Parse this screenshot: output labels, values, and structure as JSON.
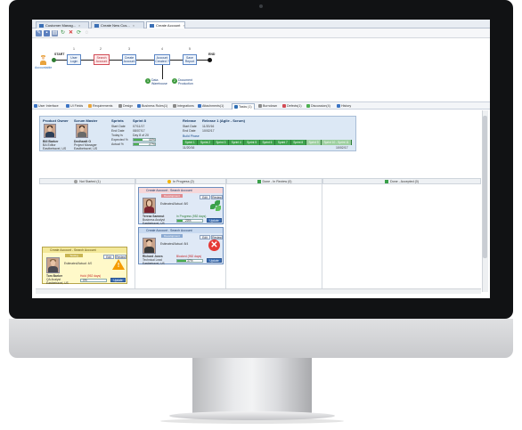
{
  "tabs": [
    {
      "label": "Customer Manag...",
      "active": false
    },
    {
      "label": "Create New Cus...",
      "active": false
    },
    {
      "label": "Create Account",
      "active": true
    }
  ],
  "toolbar": {
    "icons": [
      "edit-icon",
      "save-icon",
      "print-icon",
      "refresh-icon",
      "delete-icon",
      "workflow-icon",
      "help-icon"
    ]
  },
  "workflow": {
    "actor": "Accountable",
    "start": "START",
    "end": "END",
    "steps": [
      {
        "num": "1",
        "label": "User Login"
      },
      {
        "num": "2",
        "label": "Search Account",
        "current": true
      },
      {
        "num": "3",
        "label": "Create Account"
      },
      {
        "num": "4",
        "label": "Account Created ?"
      },
      {
        "num": "5",
        "label": "Save Report"
      }
    ],
    "branch": [
      {
        "num": "1",
        "label": "Data Warehouse"
      },
      {
        "num": "2",
        "label": "Document Production"
      }
    ]
  },
  "section_tabs": [
    {
      "label": "User Interface",
      "color": "#3b74c4"
    },
    {
      "label": "UI Fields",
      "color": "#3b74c4"
    },
    {
      "label": "Requirements",
      "color": "#e9a53a"
    },
    {
      "label": "Design",
      "color": "#8a8a8a"
    },
    {
      "label": "Business Rules(1)",
      "color": "#3b74c4"
    },
    {
      "label": "Integrations",
      "color": "#8a8a8a"
    },
    {
      "label": "Attachments(1)",
      "color": "#3b74c4"
    },
    {
      "label": "Tasks (1)",
      "color": "#2f6eb3",
      "active": true
    },
    {
      "label": "Burndown",
      "color": "#8a8a8a"
    },
    {
      "label": "Defects(1)",
      "color": "#d24b55"
    },
    {
      "label": "Discussion(4)",
      "color": "#4caf50"
    },
    {
      "label": "History",
      "color": "#3b74c4"
    }
  ],
  "info": {
    "product_owner": {
      "title": "Product Owner",
      "name": "Bill Barker",
      "role": "BA Editor",
      "place": "Eastbetravel, US"
    },
    "scrum_master": {
      "title": "Scrum Master",
      "name": "Dedhardt O",
      "role": "Project Manager",
      "place": "Eastbetravel, US"
    },
    "sprints": {
      "title": "Sprints",
      "name": "Sprint 8",
      "rows": [
        {
          "label": "Start Date",
          "value": "07/11/17"
        },
        {
          "label": "End Date",
          "value": "08/07/17"
        },
        {
          "label": "Today is",
          "value": "Day 8 of 20"
        },
        {
          "label": "Expected %",
          "value": "40%",
          "pct": 0.4
        },
        {
          "label": "Actual %",
          "value": "27%",
          "pct": 0.27
        }
      ]
    },
    "release": {
      "title": "Release",
      "name": "Release 1 (Agile - Scrum)",
      "rows": [
        {
          "label": "Start Date",
          "value": "11/20/16"
        },
        {
          "label": "End Date",
          "value": "10/02/17"
        }
      ],
      "phase": "Build Phase",
      "sprints": [
        "Sprint 1",
        "Sprint 2",
        "Sprint 3",
        "Sprint 4",
        "Sprint 5",
        "Sprint 6",
        "Sprint 7",
        "Sprint 8",
        "Sprint 9",
        "Sprint 10 - Sprint 11"
      ],
      "start_label": "11/20/16",
      "end_label": "10/02/17"
    }
  },
  "kanban": {
    "columns": [
      {
        "label": "Not Started (1)",
        "color": "#9e9e9e"
      },
      {
        "label": "In Progress (2)",
        "color": "#f5b400"
      },
      {
        "label": "Done - In Review (0)",
        "color": "#3aa04a"
      },
      {
        "label": "Done - Accepted (0)",
        "color": "#3aa04a"
      }
    ],
    "cards": [
      {
        "title": "Create Account - Search Account",
        "tag": "Development",
        "edit": "Edit",
        "review": "Review",
        "name": "Teresa Sammut",
        "role": "Business Analyst",
        "place": "Eastbetravel, US",
        "estimate": "Estimated/Actual: 8/0",
        "status": "In Progress (952 days)",
        "progress": "20%",
        "progress_pct": 0.2,
        "update": "Update",
        "icon": "leaf-icon"
      },
      {
        "title": "Create Account - Search Account",
        "tag": "Development",
        "edit": "Edit",
        "review": "Review",
        "name": "Richard Jones",
        "role": "Technical Lead",
        "place": "Eastbetravel, US",
        "estimate": "Estimated/Actual: 8/4",
        "status": "Blocked (952 days)",
        "progress": "37%",
        "progress_pct": 0.37,
        "update": "Update",
        "icon": "blocked-icon"
      },
      {
        "title": "Create Account - Search Account",
        "tag": "Testing",
        "edit": "Edit",
        "review": "Review",
        "name": "Tom Barker",
        "role": "QA Analyst",
        "place": "Eastbetravel, US",
        "estimate": "Estimated/Actual: 4/0",
        "status": "Hold (952 days)",
        "progress": "0%",
        "progress_pct": 0,
        "update": "Update",
        "icon": "warning-icon"
      }
    ]
  }
}
